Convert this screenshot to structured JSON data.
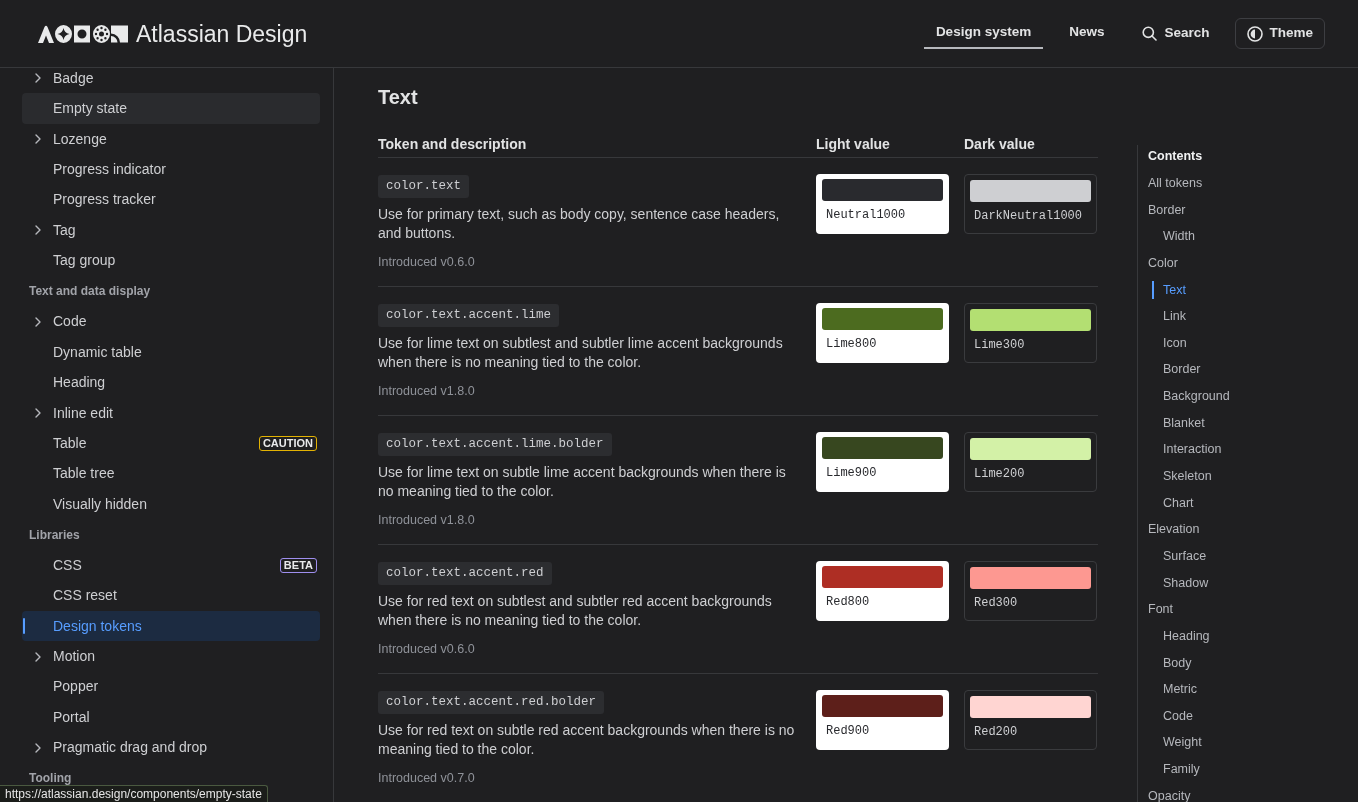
{
  "header": {
    "logo_text": "Atlassian Design",
    "nav": [
      {
        "label": "Design system",
        "selected": true
      },
      {
        "label": "News",
        "selected": false
      }
    ],
    "search": {
      "label": "Search"
    },
    "theme_button": {
      "label": "Theme"
    }
  },
  "sidebar": {
    "items": [
      {
        "kind": "item",
        "label": "Badge",
        "expandable": true,
        "hovered": false,
        "selected": false
      },
      {
        "kind": "item",
        "label": "Empty state",
        "expandable": false,
        "hovered": true,
        "selected": false
      },
      {
        "kind": "item",
        "label": "Lozenge",
        "expandable": true,
        "hovered": false,
        "selected": false
      },
      {
        "kind": "item",
        "label": "Progress indicator",
        "expandable": false,
        "hovered": false,
        "selected": false
      },
      {
        "kind": "item",
        "label": "Progress tracker",
        "expandable": false,
        "hovered": false,
        "selected": false
      },
      {
        "kind": "item",
        "label": "Tag",
        "expandable": true,
        "hovered": false,
        "selected": false
      },
      {
        "kind": "item",
        "label": "Tag group",
        "expandable": false,
        "hovered": false,
        "selected": false
      },
      {
        "kind": "section",
        "label": "Text and data display"
      },
      {
        "kind": "item",
        "label": "Code",
        "expandable": true,
        "hovered": false,
        "selected": false
      },
      {
        "kind": "item",
        "label": "Dynamic table",
        "expandable": false,
        "hovered": false,
        "selected": false
      },
      {
        "kind": "item",
        "label": "Heading",
        "expandable": false,
        "hovered": false,
        "selected": false
      },
      {
        "kind": "item",
        "label": "Inline edit",
        "expandable": true,
        "hovered": false,
        "selected": false
      },
      {
        "kind": "item",
        "label": "Table",
        "expandable": false,
        "hovered": false,
        "selected": false,
        "badge": {
          "label": "CAUTION",
          "color": "#e2b203"
        }
      },
      {
        "kind": "item",
        "label": "Table tree",
        "expandable": false,
        "hovered": false,
        "selected": false
      },
      {
        "kind": "item",
        "label": "Visually hidden",
        "expandable": false,
        "hovered": false,
        "selected": false
      },
      {
        "kind": "section",
        "label": "Libraries"
      },
      {
        "kind": "item",
        "label": "CSS",
        "expandable": false,
        "hovered": false,
        "selected": false,
        "badge": {
          "label": "BETA",
          "color": "#9f8fef"
        }
      },
      {
        "kind": "item",
        "label": "CSS reset",
        "expandable": false,
        "hovered": false,
        "selected": false
      },
      {
        "kind": "item",
        "label": "Design tokens",
        "expandable": false,
        "hovered": false,
        "selected": true
      },
      {
        "kind": "item",
        "label": "Motion",
        "expandable": true,
        "hovered": false,
        "selected": false
      },
      {
        "kind": "item",
        "label": "Popper",
        "expandable": false,
        "hovered": false,
        "selected": false
      },
      {
        "kind": "item",
        "label": "Portal",
        "expandable": false,
        "hovered": false,
        "selected": false
      },
      {
        "kind": "item",
        "label": "Pragmatic drag and drop",
        "expandable": true,
        "hovered": false,
        "selected": false
      },
      {
        "kind": "section",
        "label": "Tooling"
      }
    ]
  },
  "section_title": "Text",
  "table": {
    "columns": [
      "Token and description",
      "Light value",
      "Dark value"
    ],
    "rows": [
      {
        "token": "color.text",
        "description": "Use for primary text, such as body copy, sentence case headers, and buttons.",
        "introduced": "Introduced v0.6.0",
        "light": {
          "name": "Neutral1000",
          "color": "#292a2e"
        },
        "dark": {
          "name": "DarkNeutral1000",
          "color": "#cecfd2"
        }
      },
      {
        "token": "color.text.accent.lime",
        "description": "Use for lime text on subtlest and subtler lime accent backgrounds when there is no meaning tied to the color.",
        "introduced": "Introduced v1.8.0",
        "light": {
          "name": "Lime800",
          "color": "#4c6b1f"
        },
        "dark": {
          "name": "Lime300",
          "color": "#b3df72"
        }
      },
      {
        "token": "color.text.accent.lime.bolder",
        "description": "Use for lime text on subtle lime accent backgrounds when there is no meaning tied to the color.",
        "introduced": "Introduced v1.8.0",
        "light": {
          "name": "Lime900",
          "color": "#37471f"
        },
        "dark": {
          "name": "Lime200",
          "color": "#d3f1a7"
        }
      },
      {
        "token": "color.text.accent.red",
        "description": "Use for red text on subtlest and subtler red accent backgrounds when there is no meaning tied to the color.",
        "introduced": "Introduced v0.6.0",
        "light": {
          "name": "Red800",
          "color": "#ae2e24"
        },
        "dark": {
          "name": "Red300",
          "color": "#fd9891"
        }
      },
      {
        "token": "color.text.accent.red.bolder",
        "description": "Use for red text on subtle red accent backgrounds when there is no meaning tied to the color.",
        "introduced": "Introduced v0.7.0",
        "light": {
          "name": "Red900",
          "color": "#5d1f1a"
        },
        "dark": {
          "name": "Red200",
          "color": "#ffd5d2"
        }
      }
    ]
  },
  "contents": {
    "title": "Contents",
    "items": [
      {
        "label": "All tokens",
        "selected": false
      },
      {
        "label": "Border",
        "selected": false,
        "children": [
          {
            "label": "Width",
            "selected": false
          }
        ]
      },
      {
        "label": "Color",
        "selected": false,
        "children": [
          {
            "label": "Text",
            "selected": true
          },
          {
            "label": "Link",
            "selected": false
          },
          {
            "label": "Icon",
            "selected": false
          },
          {
            "label": "Border",
            "selected": false
          },
          {
            "label": "Background",
            "selected": false
          },
          {
            "label": "Blanket",
            "selected": false
          },
          {
            "label": "Interaction",
            "selected": false
          },
          {
            "label": "Skeleton",
            "selected": false
          },
          {
            "label": "Chart",
            "selected": false
          }
        ]
      },
      {
        "label": "Elevation",
        "selected": false,
        "children": [
          {
            "label": "Surface",
            "selected": false
          },
          {
            "label": "Shadow",
            "selected": false
          }
        ]
      },
      {
        "label": "Font",
        "selected": false,
        "children": [
          {
            "label": "Heading",
            "selected": false
          },
          {
            "label": "Body",
            "selected": false
          },
          {
            "label": "Metric",
            "selected": false
          },
          {
            "label": "Code",
            "selected": false
          },
          {
            "label": "Weight",
            "selected": false
          },
          {
            "label": "Family",
            "selected": false
          }
        ]
      },
      {
        "label": "Opacity",
        "selected": false
      }
    ]
  },
  "status_bar": {
    "url": "https://atlassian.design/components/empty-state"
  }
}
